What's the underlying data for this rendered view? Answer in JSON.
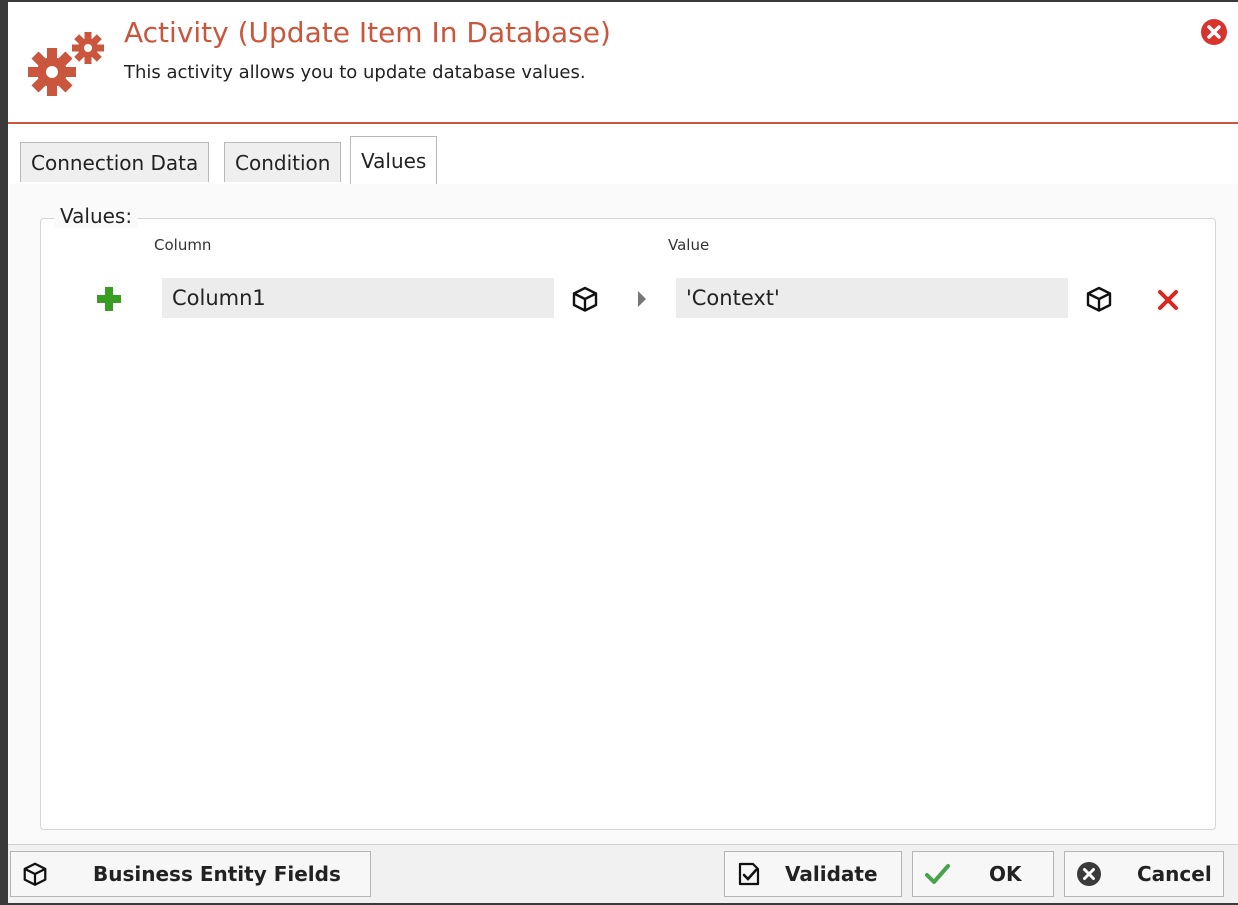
{
  "dialog": {
    "title": "Activity (Update Item In Database)",
    "subtitle": "This activity allows you to update database values.",
    "icon": "gears-icon",
    "accent_color": "#c9563d"
  },
  "tabs": [
    {
      "label": "Connection Data",
      "active": false
    },
    {
      "label": "Condition",
      "active": false
    },
    {
      "label": "Values",
      "active": true
    }
  ],
  "values_panel": {
    "group_label": "Values:",
    "column_header": "Column",
    "value_header": "Value",
    "rows": [
      {
        "column": "Column1",
        "value": "'Context'"
      }
    ]
  },
  "footer": {
    "business_entity_fields": "Business Entity Fields",
    "validate": "Validate",
    "ok": "OK",
    "cancel": "Cancel"
  }
}
